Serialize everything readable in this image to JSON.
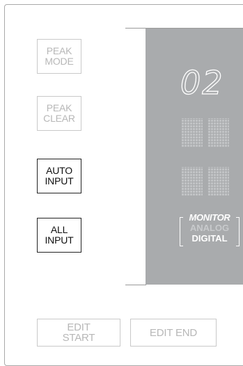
{
  "buttons": {
    "peak_mode": [
      "PEAK",
      "MODE"
    ],
    "peak_clear": [
      "PEAK",
      "CLEAR"
    ],
    "auto_input": [
      "AUTO",
      "INPUT"
    ],
    "all_input": [
      "ALL",
      "INPUT"
    ],
    "edit_start": [
      "EDIT",
      "START"
    ],
    "edit_end": "EDIT END"
  },
  "display": {
    "readout": "02",
    "monitor": {
      "title": "MONITOR",
      "options": [
        "ANALOG",
        "DIGITAL"
      ],
      "selected": "DIGITAL"
    }
  },
  "colors": {
    "display_bg": "#a9abad",
    "disabled_text": "#b7b7b7",
    "enabled_border": "#222222"
  }
}
